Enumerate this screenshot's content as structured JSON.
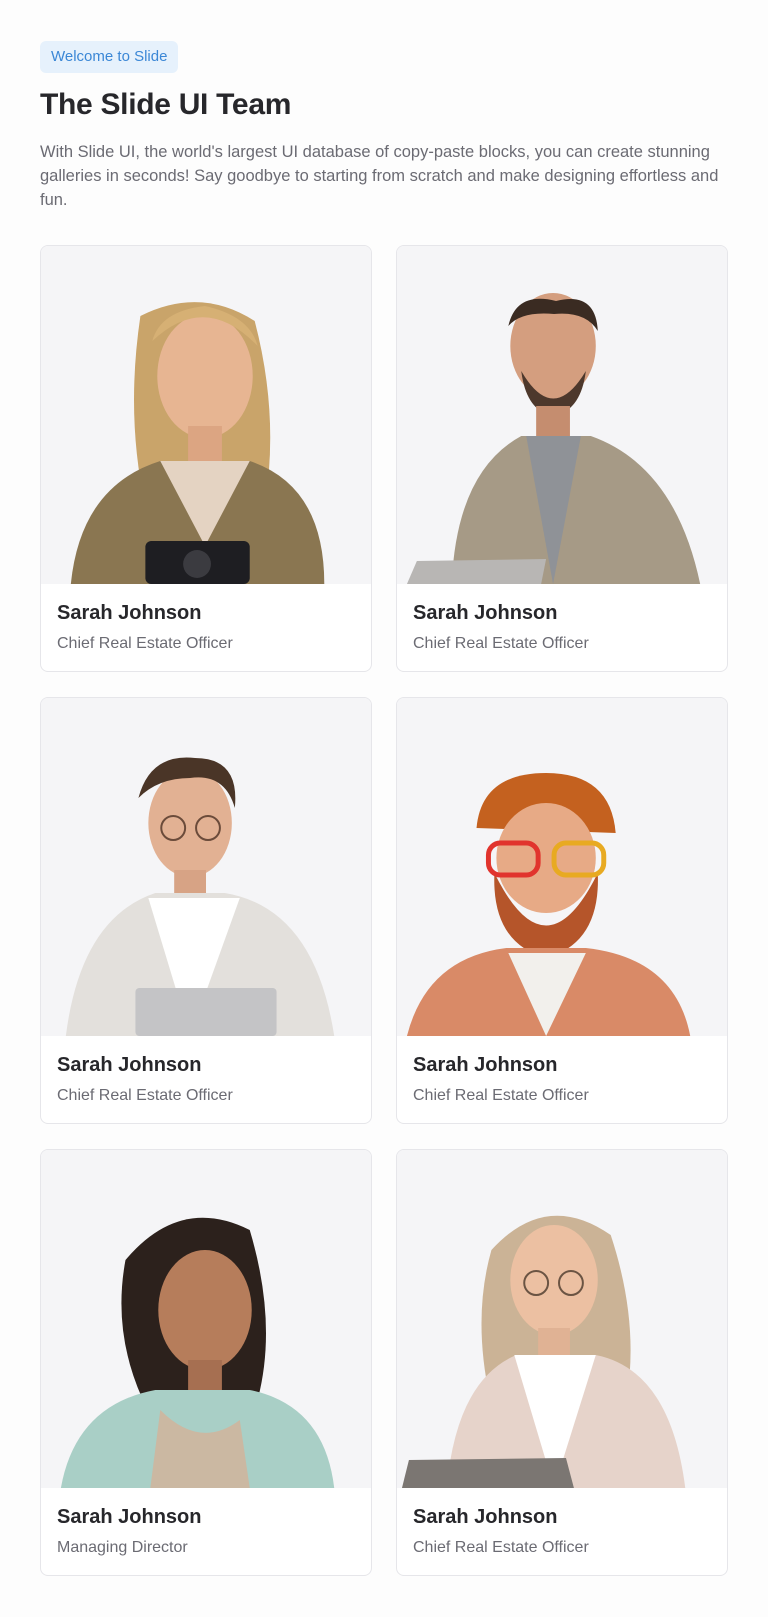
{
  "header": {
    "badge": "Welcome to Slide",
    "title": "The Slide UI Team",
    "description": "With Slide UI, the world's largest UI database of copy-paste blocks, you can create stunning galleries in seconds! Say goodbye to starting from scratch and make designing effortless and fun."
  },
  "team": [
    {
      "name": "Sarah Johnson",
      "role": "Chief Real Estate Officer"
    },
    {
      "name": "Sarah Johnson",
      "role": "Chief Real Estate Officer"
    },
    {
      "name": "Sarah Johnson",
      "role": "Chief Real Estate Officer"
    },
    {
      "name": "Sarah Johnson",
      "role": "Chief Real Estate Officer"
    },
    {
      "name": "Sarah Johnson",
      "role": "Managing Director"
    },
    {
      "name": "Sarah Johnson",
      "role": "Chief Real Estate Officer"
    }
  ]
}
